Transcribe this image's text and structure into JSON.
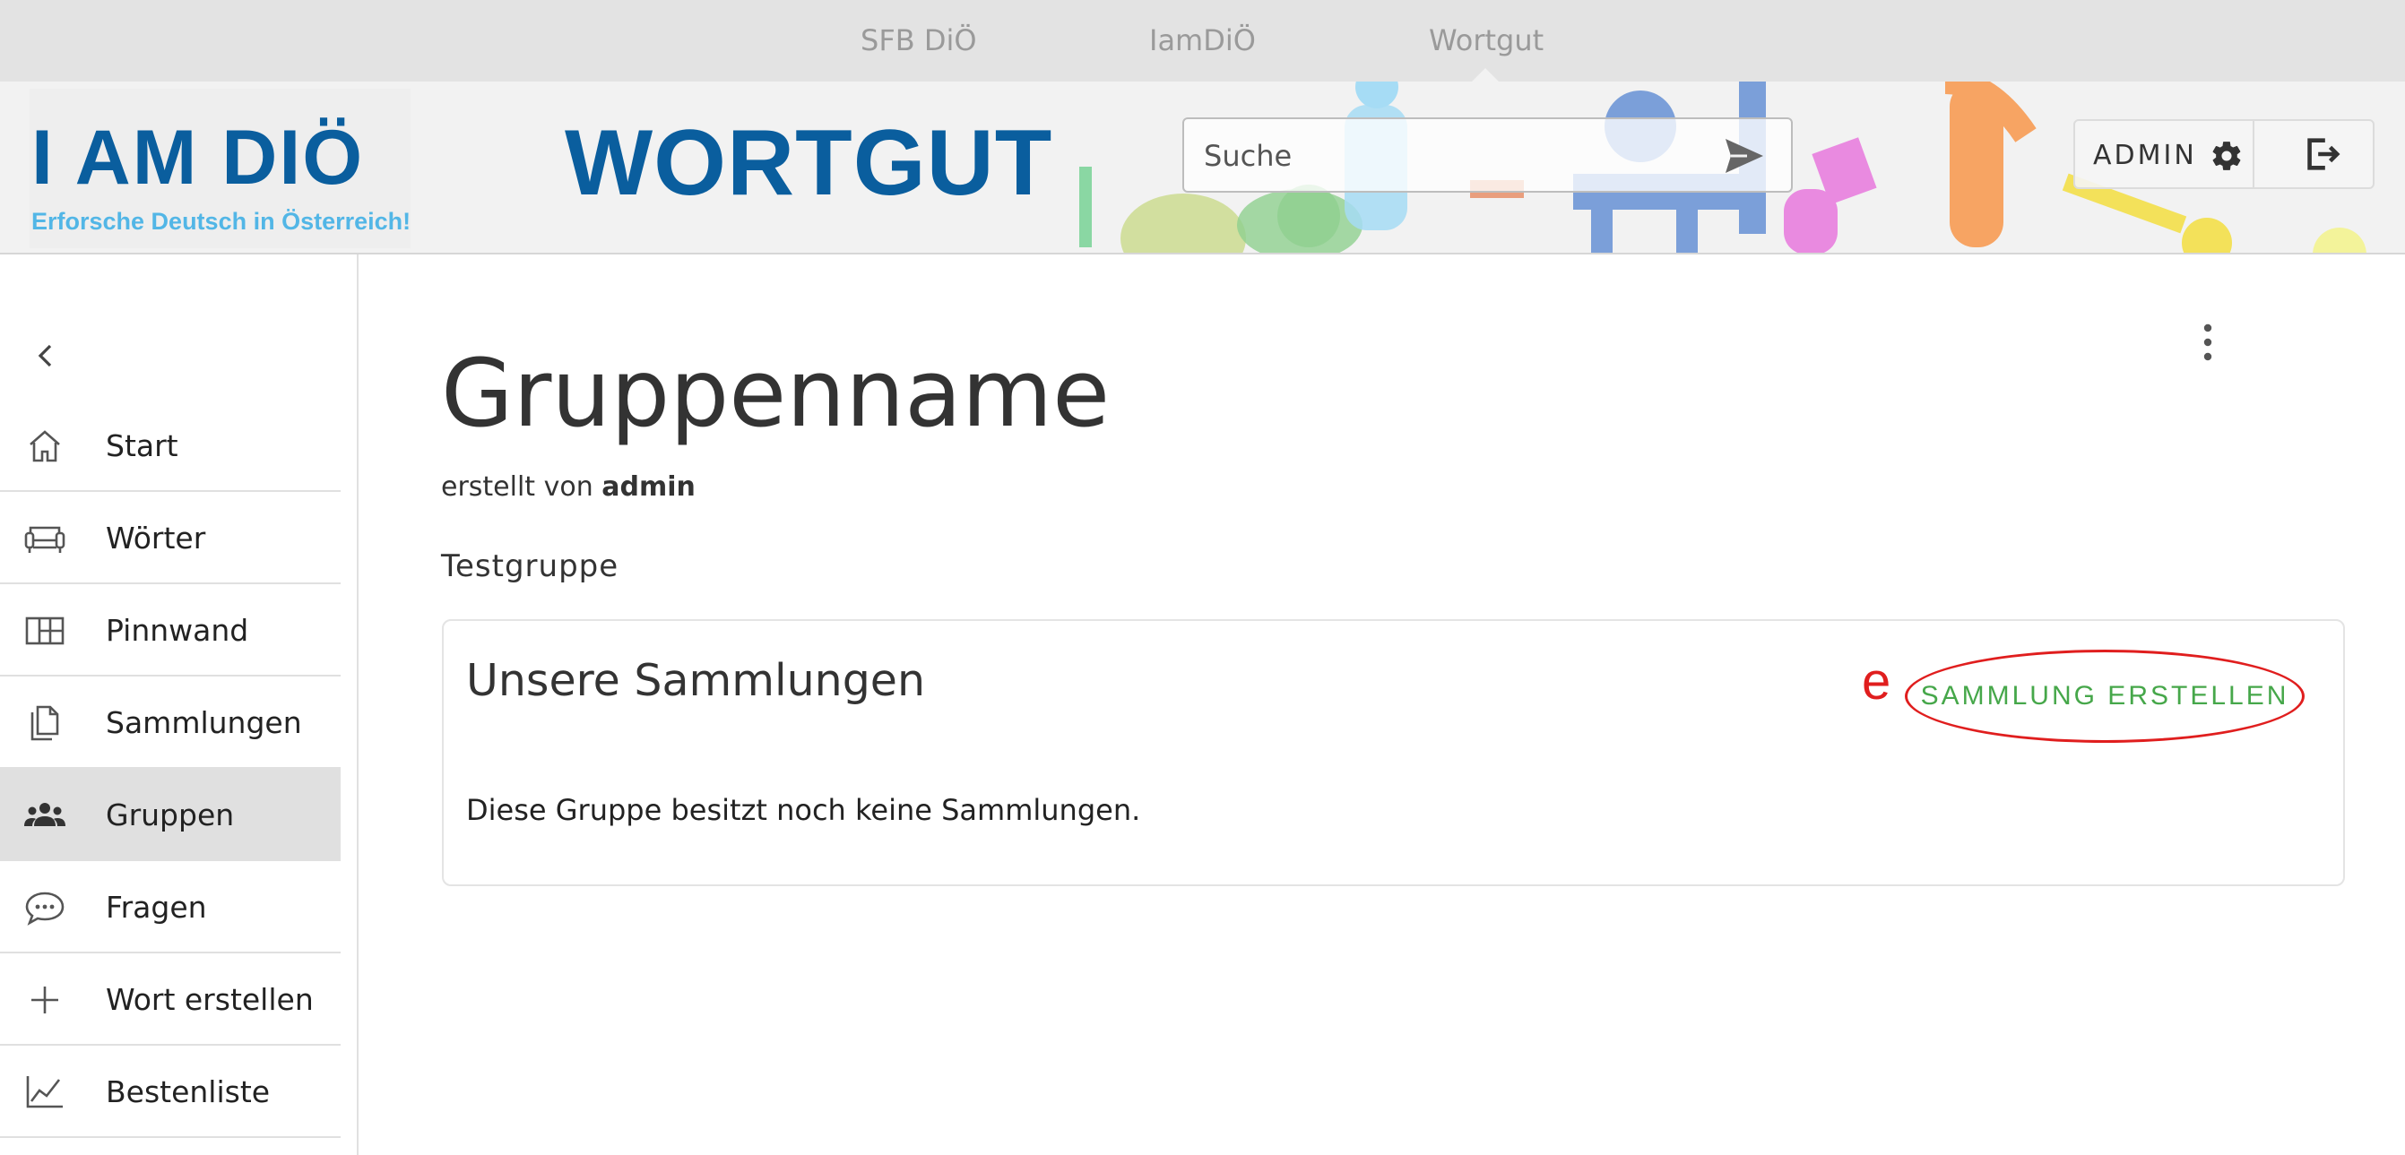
{
  "topnav": {
    "links": [
      "SFB DiÖ",
      "IamDiÖ",
      "Wortgut"
    ],
    "active": "Wortgut"
  },
  "header": {
    "logo_title": "I AM DIÖ",
    "logo_subtitle": "Erforsche Deutsch in Österreich!",
    "app_title": "WORTGUT",
    "search_placeholder": "Suche",
    "user_label": "ADMIN",
    "icons": [
      "send-icon",
      "gear-icon",
      "logout-icon"
    ]
  },
  "sidebar": {
    "collapse_icon": "chevron-left-icon",
    "items": [
      {
        "label": "Start",
        "icon": "home-icon",
        "active": false
      },
      {
        "label": "Wörter",
        "icon": "sofa-icon",
        "active": false
      },
      {
        "label": "Pinnwand",
        "icon": "board-icon",
        "active": false
      },
      {
        "label": "Sammlungen",
        "icon": "documents-icon",
        "active": false
      },
      {
        "label": "Gruppen",
        "icon": "group-icon",
        "active": true
      },
      {
        "label": "Fragen",
        "icon": "chat-bubble-icon",
        "active": false
      },
      {
        "label": "Wort erstellen",
        "icon": "plus-icon",
        "active": false
      },
      {
        "label": "Bestenliste",
        "icon": "chart-line-icon",
        "active": false
      }
    ]
  },
  "main": {
    "title": "Gruppenname",
    "created_prefix": "erstellt von",
    "created_by": "admin",
    "description": "Testgruppe",
    "collections": {
      "title": "Unsere Sammlungen",
      "empty_text": "Diese Gruppe besitzt noch keine Sammlungen.",
      "create_button": "SAMMLUNG ERSTELLEN",
      "annotation_marker": "e"
    }
  },
  "colors": {
    "brand_blue": "#0a5e9e",
    "logo_light_blue": "#52b6e6",
    "action_green": "#46a74a",
    "annotation_red": "#e01e1e",
    "active_item_bg": "#e0e0e0"
  }
}
